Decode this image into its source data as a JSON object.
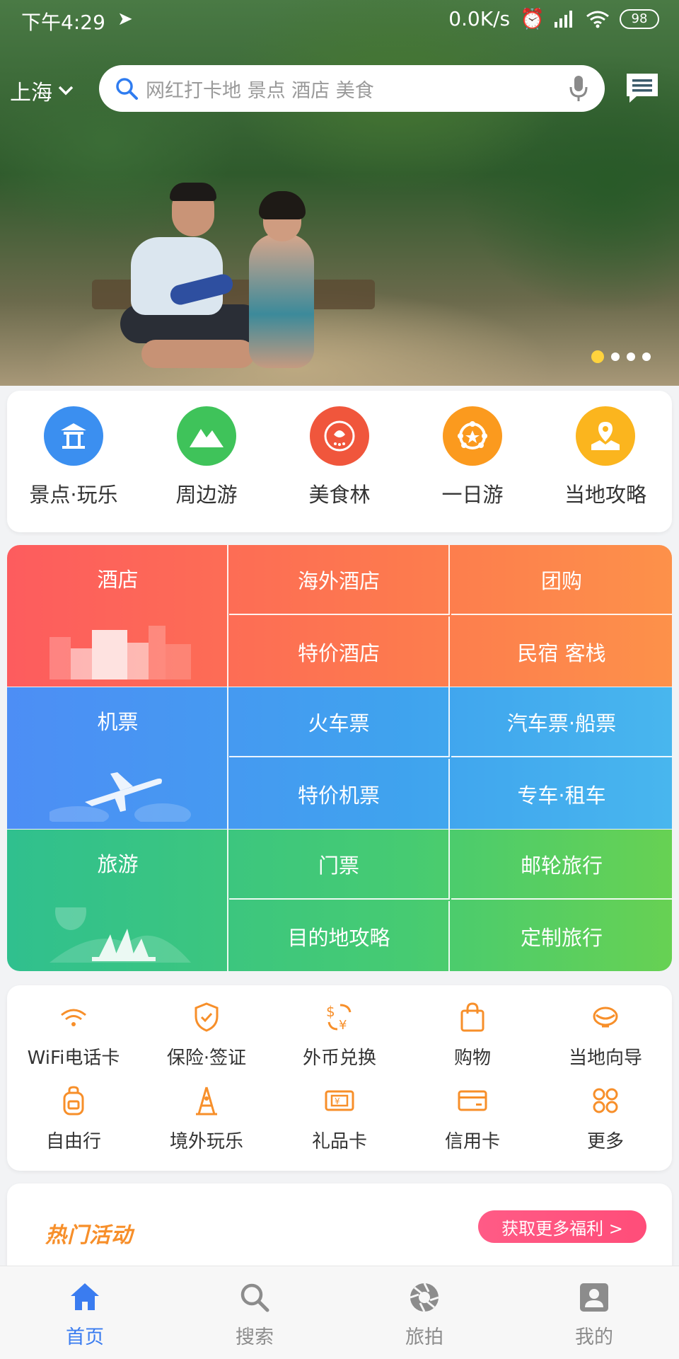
{
  "status_bar": {
    "time": "下午4:29",
    "network_speed": "0.0K/s",
    "battery": "98"
  },
  "header": {
    "city": "上海",
    "search_placeholder": "网红打卡地 景点 酒店 美食"
  },
  "banner": {
    "slide_count": 4,
    "active_slide": 1
  },
  "quick_nav": [
    {
      "label": "景点·玩乐",
      "icon": "pavilion-icon",
      "color": "#3b8ff0"
    },
    {
      "label": "周边游",
      "icon": "mountain-icon",
      "color": "#3fc35a"
    },
    {
      "label": "美食林",
      "icon": "food-badge-icon",
      "color": "#f0563c"
    },
    {
      "label": "一日游",
      "icon": "star-badge-icon",
      "color": "#fb9a1e"
    },
    {
      "label": "当地攻略",
      "icon": "location-map-icon",
      "color": "#fbb51e"
    }
  ],
  "grid": {
    "hotel": {
      "title": "酒店",
      "cells": [
        "海外酒店",
        "团购",
        "特价酒店",
        "民宿 客栈"
      ]
    },
    "flight": {
      "title": "机票",
      "cells": [
        "火车票",
        "汽车票·船票",
        "特价机票",
        "专车·租车"
      ]
    },
    "travel": {
      "title": "旅游",
      "cells": [
        "门票",
        "邮轮旅行",
        "目的地攻略",
        "定制旅行"
      ]
    }
  },
  "services": [
    {
      "label": "WiFi电话卡",
      "icon": "wifi-icon"
    },
    {
      "label": "保险·签证",
      "icon": "shield-icon"
    },
    {
      "label": "外币兑换",
      "icon": "currency-exchange-icon"
    },
    {
      "label": "购物",
      "icon": "shopping-bag-icon"
    },
    {
      "label": "当地向导",
      "icon": "guide-icon"
    },
    {
      "label": "自由行",
      "icon": "backpack-icon"
    },
    {
      "label": "境外玩乐",
      "icon": "tower-icon"
    },
    {
      "label": "礼品卡",
      "icon": "gift-card-icon"
    },
    {
      "label": "信用卡",
      "icon": "credit-card-icon"
    },
    {
      "label": "更多",
      "icon": "more-grid-icon"
    }
  ],
  "hot_activity": {
    "title": "热门活动",
    "button": "获取更多福利 >"
  },
  "tabbar": [
    {
      "label": "首页",
      "icon": "home-icon",
      "active": true
    },
    {
      "label": "搜索",
      "icon": "search-icon",
      "active": false
    },
    {
      "label": "旅拍",
      "icon": "camera-aperture-icon",
      "active": false
    },
    {
      "label": "我的",
      "icon": "profile-icon",
      "active": false
    }
  ],
  "colors": {
    "accent": "#3a7cf0",
    "orange": "#f78f2a",
    "pink": "#ff4d79"
  }
}
